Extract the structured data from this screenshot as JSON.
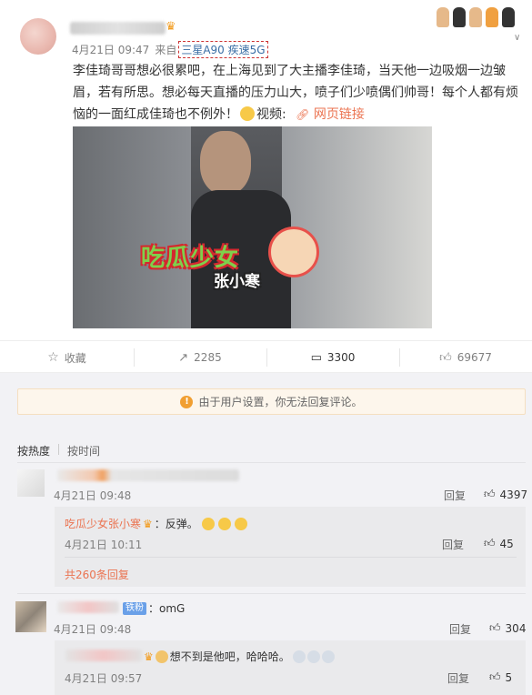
{
  "post": {
    "time": "4月21日 09:47",
    "source_prefix": "来自",
    "source_device": "三星A90 疾速5G",
    "text_main": "李佳琦哥哥想必很累吧，在上海见到了大主播李佳琦，当天他一边吸烟一边皱眉，若有所思。想必每天直播的压力山大，喷子们少喷偶们帅哥！每个人都有烦恼的一面红成佳琦也不例外！",
    "text_video_label": "视频:",
    "link_label": "网页链接",
    "watermark_main": "吃瓜少女",
    "watermark_sub": "张小寒"
  },
  "actions": {
    "favorite_label": "收藏",
    "forward_count": "2285",
    "comment_count": "3300",
    "like_count": "69677"
  },
  "notice": {
    "text": "由于用户设置，你无法回复评论。"
  },
  "sort": {
    "hot_label": "按热度",
    "time_label": "按时间"
  },
  "comments": [
    {
      "time": "4月21日 09:48",
      "reply_label": "回复",
      "likes": "4397",
      "replies": [
        {
          "author": "吃瓜少女张小寒",
          "text": "：反弹。",
          "time": "4月21日 10:11",
          "reply_label": "回复",
          "likes": "45"
        }
      ],
      "more_label": "共260条回复"
    },
    {
      "badge": "铁粉",
      "text": "：omG",
      "time": "4月21日 09:48",
      "reply_label": "回复",
      "likes": "304",
      "replies": [
        {
          "text": "想不到是他吧，哈哈哈。",
          "time": "4月21日 09:57",
          "reply_label": "回复",
          "likes": "5"
        }
      ]
    }
  ],
  "colors": {
    "accent": "#eb7350",
    "notice_bg": "#fdf6ec",
    "notice_icon": "#f19f32",
    "list_bg": "#f2f2f5"
  }
}
